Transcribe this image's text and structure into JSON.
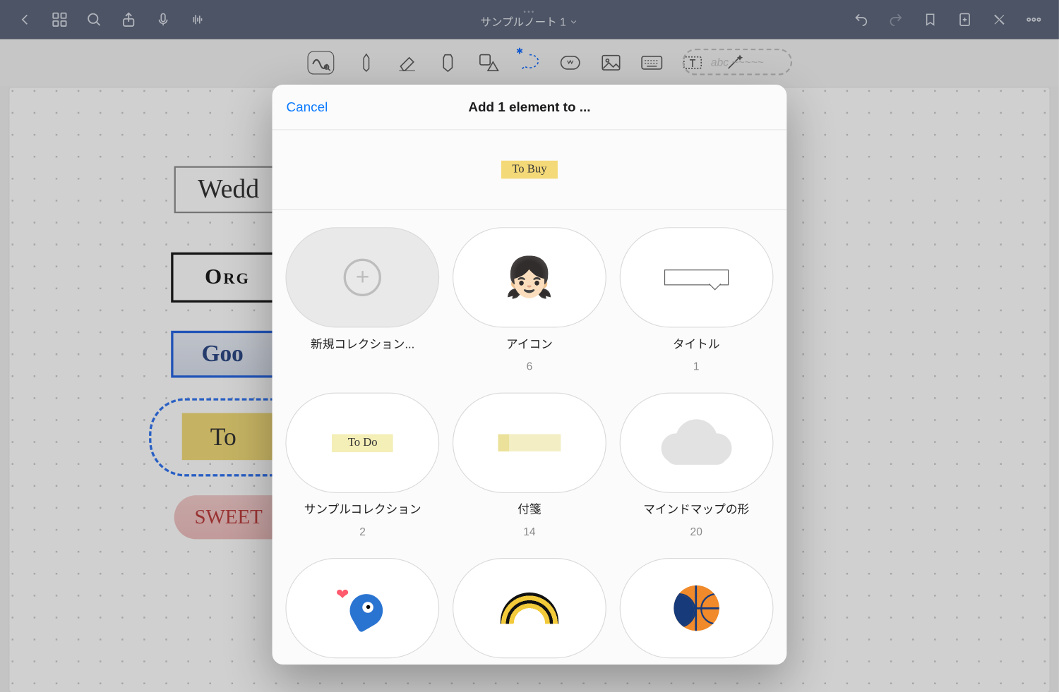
{
  "topbar": {
    "notebook_title": "サンプルノート 1",
    "handwrite_hint": "abc ~~~~~"
  },
  "notes": {
    "wed": "Wedd",
    "org": "Org",
    "goo": "Goo",
    "to": "To",
    "sweet": "SWEET"
  },
  "modal": {
    "cancel": "Cancel",
    "title": "Add 1 element to ...",
    "preview_text": "To Buy",
    "collections": [
      {
        "label": "新規コレクション...",
        "count": ""
      },
      {
        "label": "アイコン",
        "count": "6"
      },
      {
        "label": "タイトル",
        "count": "1"
      },
      {
        "label": "サンプルコレクション",
        "count": "2",
        "chip": "To Do"
      },
      {
        "label": "付箋",
        "count": "14"
      },
      {
        "label": "マインドマップの形",
        "count": "20"
      },
      {
        "label": "",
        "count": ""
      },
      {
        "label": "",
        "count": ""
      },
      {
        "label": "",
        "count": ""
      }
    ]
  }
}
